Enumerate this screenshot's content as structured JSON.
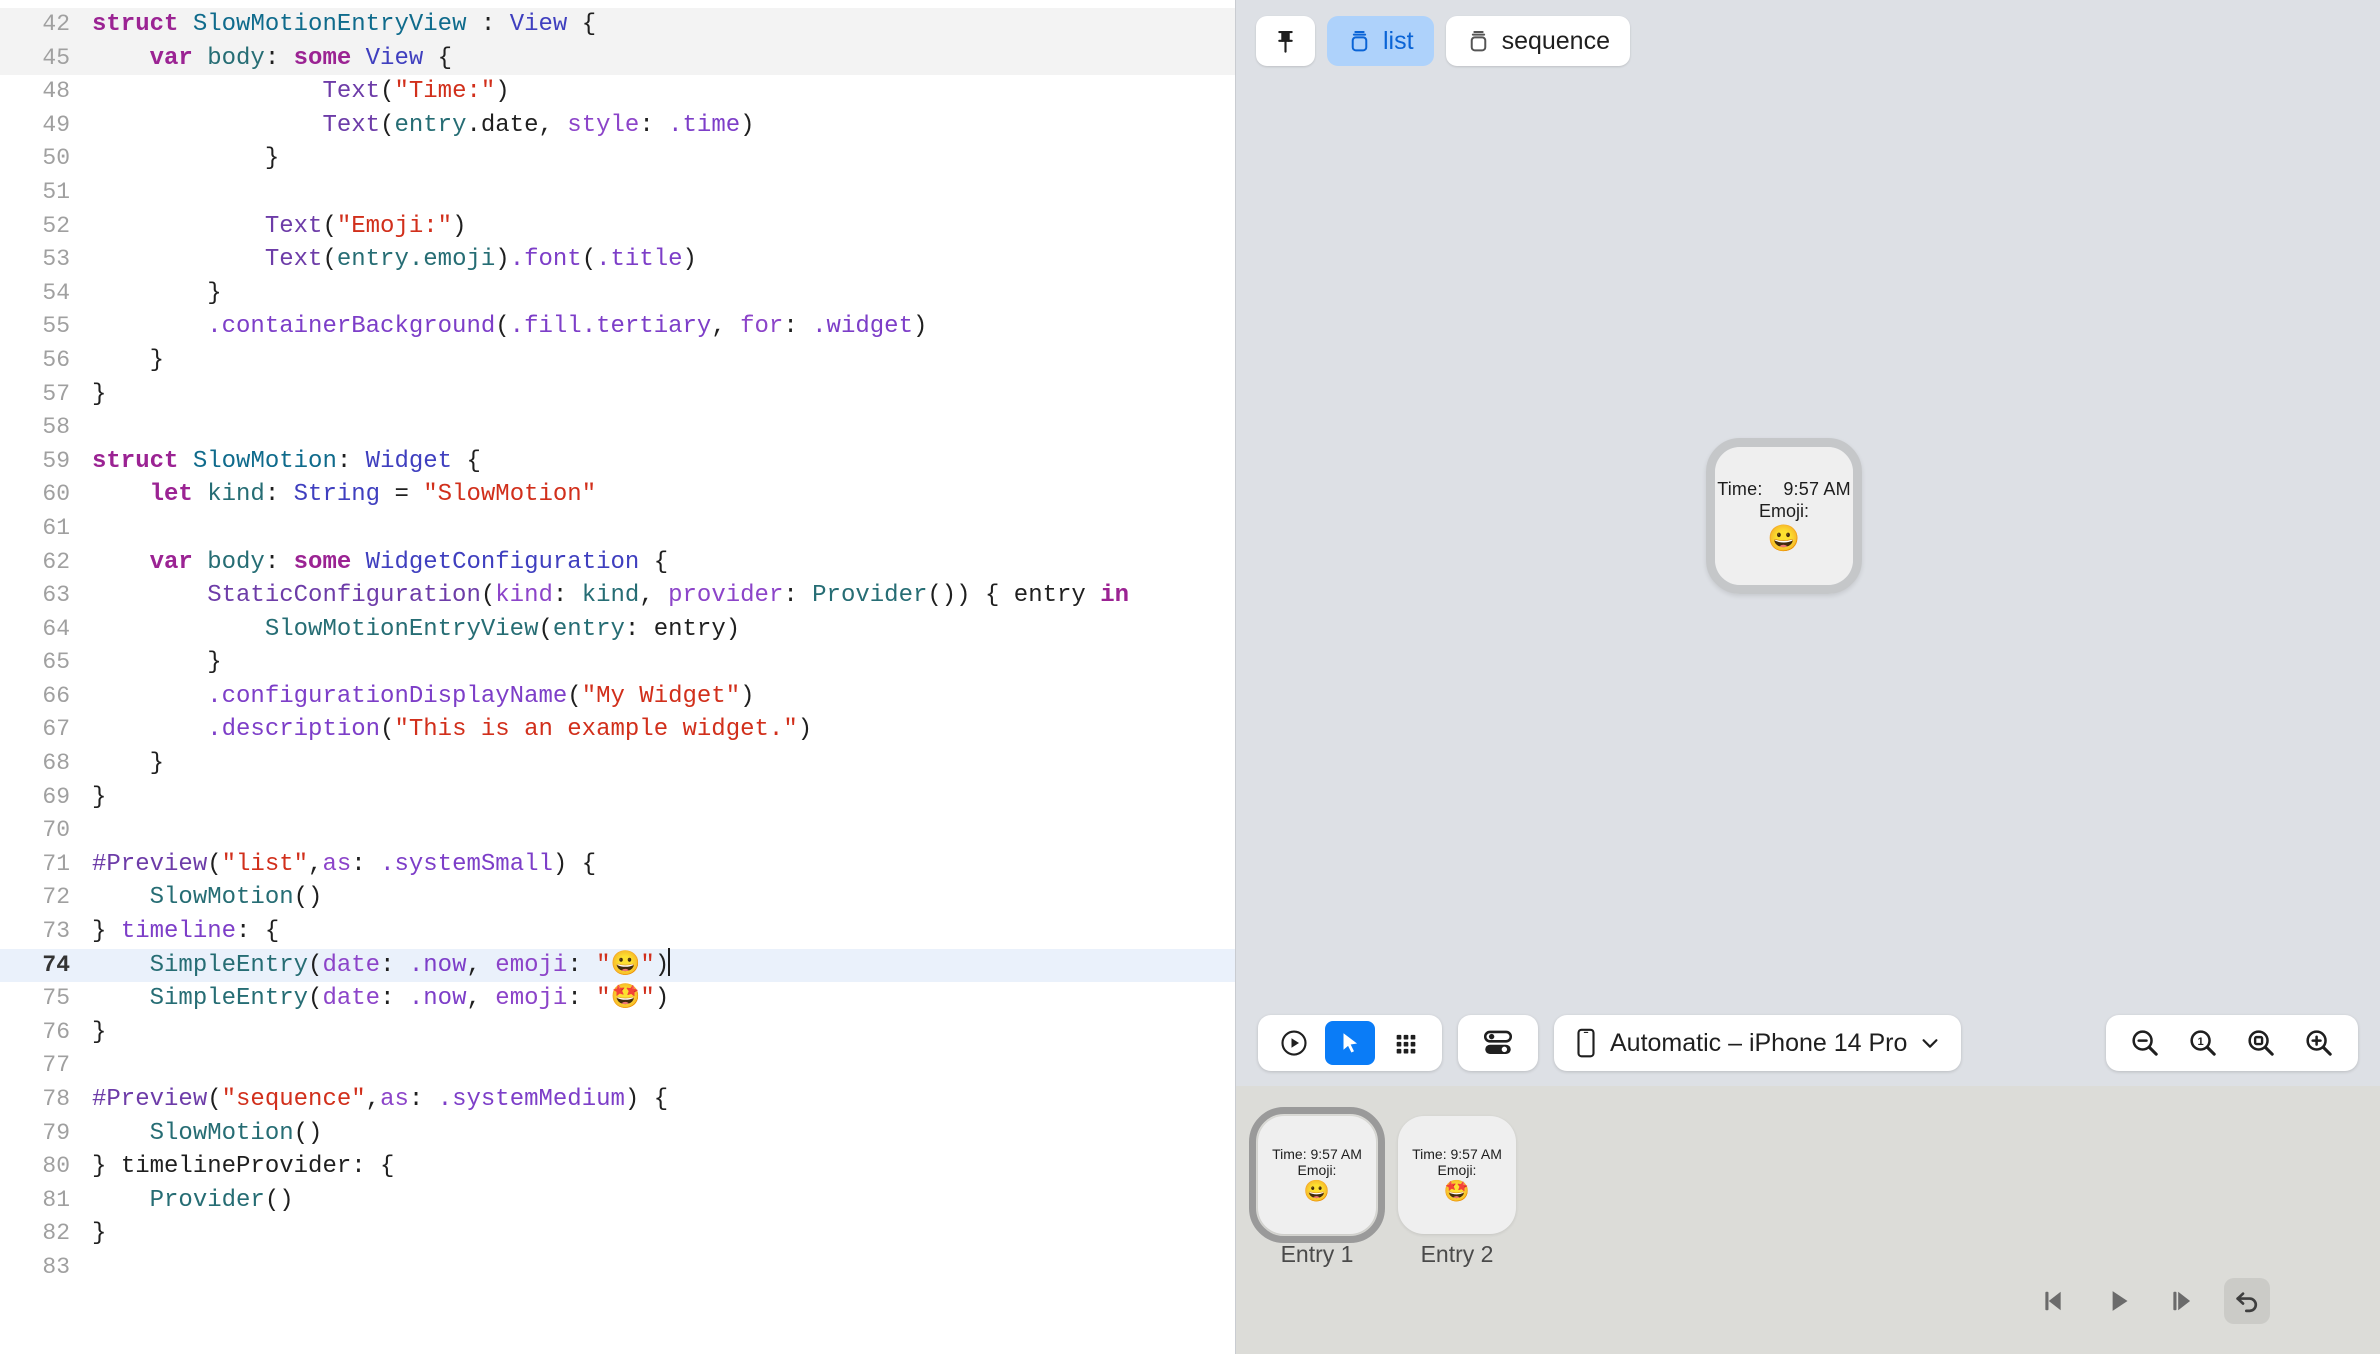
{
  "editor": {
    "language": "swift",
    "current_line": 74,
    "folded_lines": [
      42,
      45
    ],
    "lines": [
      {
        "no": "42",
        "state": "folded",
        "tokens": [
          {
            "t": "struct ",
            "c": "kw"
          },
          {
            "t": "SlowMotionEntryView",
            "c": "typ"
          },
          {
            "t": " : ",
            "c": "pln"
          },
          {
            "t": "View",
            "c": "typ2"
          },
          {
            "t": " {",
            "c": "pln"
          }
        ]
      },
      {
        "no": "45",
        "state": "folded",
        "indent": 1,
        "tokens": [
          {
            "t": "    ",
            "c": "pln"
          },
          {
            "t": "var ",
            "c": "kw"
          },
          {
            "t": "body",
            "c": "idn"
          },
          {
            "t": ": ",
            "c": "pln"
          },
          {
            "t": "some ",
            "c": "kw"
          },
          {
            "t": "View",
            "c": "typ2"
          },
          {
            "t": " {",
            "c": "pln"
          }
        ]
      },
      {
        "no": "48",
        "state": "normal",
        "tokens": [
          {
            "t": "                ",
            "c": "pln"
          },
          {
            "t": "Text",
            "c": "fn"
          },
          {
            "t": "(",
            "c": "pln"
          },
          {
            "t": "\"Time:\"",
            "c": "str"
          },
          {
            "t": ")",
            "c": "pln"
          }
        ]
      },
      {
        "no": "49",
        "state": "normal",
        "tokens": [
          {
            "t": "                ",
            "c": "pln"
          },
          {
            "t": "Text",
            "c": "fn"
          },
          {
            "t": "(",
            "c": "pln"
          },
          {
            "t": "entry",
            "c": "idn"
          },
          {
            "t": ".date",
            "c": "pln"
          },
          {
            "t": ", ",
            "c": "pln"
          },
          {
            "t": "style",
            "c": "plbl"
          },
          {
            "t": ": ",
            "c": "pln"
          },
          {
            "t": ".time",
            "c": "prop"
          },
          {
            "t": ")",
            "c": "pln"
          }
        ]
      },
      {
        "no": "50",
        "state": "normal",
        "tokens": [
          {
            "t": "            }",
            "c": "pln"
          }
        ]
      },
      {
        "no": "51",
        "state": "normal",
        "tokens": []
      },
      {
        "no": "52",
        "state": "normal",
        "tokens": [
          {
            "t": "            ",
            "c": "pln"
          },
          {
            "t": "Text",
            "c": "fn"
          },
          {
            "t": "(",
            "c": "pln"
          },
          {
            "t": "\"Emoji:\"",
            "c": "str"
          },
          {
            "t": ")",
            "c": "pln"
          }
        ]
      },
      {
        "no": "53",
        "state": "normal",
        "tokens": [
          {
            "t": "            ",
            "c": "pln"
          },
          {
            "t": "Text",
            "c": "fn"
          },
          {
            "t": "(",
            "c": "pln"
          },
          {
            "t": "entry",
            "c": "idn"
          },
          {
            "t": ".emoji",
            "c": "idn"
          },
          {
            "t": ")",
            "c": "pln"
          },
          {
            "t": ".font",
            "c": "prop"
          },
          {
            "t": "(",
            "c": "pln"
          },
          {
            "t": ".title",
            "c": "prop"
          },
          {
            "t": ")",
            "c": "pln"
          }
        ]
      },
      {
        "no": "54",
        "state": "normal",
        "tokens": [
          {
            "t": "        }",
            "c": "pln"
          }
        ]
      },
      {
        "no": "55",
        "state": "normal",
        "tokens": [
          {
            "t": "        ",
            "c": "pln"
          },
          {
            "t": ".containerBackground",
            "c": "prop"
          },
          {
            "t": "(",
            "c": "pln"
          },
          {
            "t": ".fill",
            "c": "prop"
          },
          {
            "t": ".tertiary",
            "c": "prop"
          },
          {
            "t": ", ",
            "c": "pln"
          },
          {
            "t": "for",
            "c": "plbl"
          },
          {
            "t": ": ",
            "c": "pln"
          },
          {
            "t": ".widget",
            "c": "prop"
          },
          {
            "t": ")",
            "c": "pln"
          }
        ]
      },
      {
        "no": "56",
        "state": "normal",
        "tokens": [
          {
            "t": "    }",
            "c": "pln"
          }
        ]
      },
      {
        "no": "57",
        "state": "normal",
        "tokens": [
          {
            "t": "}",
            "c": "pln"
          }
        ]
      },
      {
        "no": "58",
        "state": "normal",
        "tokens": []
      },
      {
        "no": "59",
        "state": "normal",
        "tokens": [
          {
            "t": "struct ",
            "c": "kw"
          },
          {
            "t": "SlowMotion",
            "c": "typ"
          },
          {
            "t": ": ",
            "c": "pln"
          },
          {
            "t": "Widget",
            "c": "typ2"
          },
          {
            "t": " {",
            "c": "pln"
          }
        ]
      },
      {
        "no": "60",
        "state": "normal",
        "tokens": [
          {
            "t": "    ",
            "c": "pln"
          },
          {
            "t": "let ",
            "c": "kw"
          },
          {
            "t": "kind",
            "c": "idn"
          },
          {
            "t": ": ",
            "c": "pln"
          },
          {
            "t": "String",
            "c": "typ2"
          },
          {
            "t": " = ",
            "c": "pln"
          },
          {
            "t": "\"SlowMotion\"",
            "c": "str"
          }
        ]
      },
      {
        "no": "61",
        "state": "normal",
        "tokens": []
      },
      {
        "no": "62",
        "state": "normal",
        "tokens": [
          {
            "t": "    ",
            "c": "pln"
          },
          {
            "t": "var ",
            "c": "kw"
          },
          {
            "t": "body",
            "c": "idn"
          },
          {
            "t": ": ",
            "c": "pln"
          },
          {
            "t": "some ",
            "c": "kw"
          },
          {
            "t": "WidgetConfiguration",
            "c": "typ2"
          },
          {
            "t": " {",
            "c": "pln"
          }
        ]
      },
      {
        "no": "63",
        "state": "normal",
        "tokens": [
          {
            "t": "        ",
            "c": "pln"
          },
          {
            "t": "StaticConfiguration",
            "c": "fn"
          },
          {
            "t": "(",
            "c": "pln"
          },
          {
            "t": "kind",
            "c": "plbl"
          },
          {
            "t": ": ",
            "c": "pln"
          },
          {
            "t": "kind",
            "c": "idn"
          },
          {
            "t": ", ",
            "c": "pln"
          },
          {
            "t": "provider",
            "c": "plbl"
          },
          {
            "t": ": ",
            "c": "pln"
          },
          {
            "t": "Provider",
            "c": "idn"
          },
          {
            "t": "()) { ",
            "c": "pln"
          },
          {
            "t": "entry",
            "c": "pln"
          },
          {
            "t": " ",
            "c": "pln"
          },
          {
            "t": "in",
            "c": "kw"
          }
        ]
      },
      {
        "no": "64",
        "state": "normal",
        "tokens": [
          {
            "t": "            ",
            "c": "pln"
          },
          {
            "t": "SlowMotionEntryView",
            "c": "idn"
          },
          {
            "t": "(",
            "c": "pln"
          },
          {
            "t": "entry",
            "c": "idn"
          },
          {
            "t": ": ",
            "c": "pln"
          },
          {
            "t": "entry",
            "c": "pln"
          },
          {
            "t": ")",
            "c": "pln"
          }
        ]
      },
      {
        "no": "65",
        "state": "normal",
        "tokens": [
          {
            "t": "        }",
            "c": "pln"
          }
        ]
      },
      {
        "no": "66",
        "state": "normal",
        "tokens": [
          {
            "t": "        ",
            "c": "pln"
          },
          {
            "t": ".configurationDisplayName",
            "c": "prop"
          },
          {
            "t": "(",
            "c": "pln"
          },
          {
            "t": "\"My Widget\"",
            "c": "str"
          },
          {
            "t": ")",
            "c": "pln"
          }
        ]
      },
      {
        "no": "67",
        "state": "normal",
        "tokens": [
          {
            "t": "        ",
            "c": "pln"
          },
          {
            "t": ".description",
            "c": "prop"
          },
          {
            "t": "(",
            "c": "pln"
          },
          {
            "t": "\"This is an example widget.\"",
            "c": "str"
          },
          {
            "t": ")",
            "c": "pln"
          }
        ]
      },
      {
        "no": "68",
        "state": "normal",
        "tokens": [
          {
            "t": "    }",
            "c": "pln"
          }
        ]
      },
      {
        "no": "69",
        "state": "normal",
        "tokens": [
          {
            "t": "}",
            "c": "pln"
          }
        ]
      },
      {
        "no": "70",
        "state": "normal",
        "tokens": []
      },
      {
        "no": "71",
        "state": "normal",
        "tokens": [
          {
            "t": "#Preview",
            "c": "macro"
          },
          {
            "t": "(",
            "c": "pln"
          },
          {
            "t": "\"list\"",
            "c": "str"
          },
          {
            "t": ",",
            "c": "pln"
          },
          {
            "t": "as",
            "c": "plbl"
          },
          {
            "t": ": ",
            "c": "pln"
          },
          {
            "t": ".systemSmall",
            "c": "prop"
          },
          {
            "t": ") {",
            "c": "pln"
          }
        ]
      },
      {
        "no": "72",
        "state": "normal",
        "tokens": [
          {
            "t": "    ",
            "c": "pln"
          },
          {
            "t": "SlowMotion",
            "c": "idn"
          },
          {
            "t": "()",
            "c": "pln"
          }
        ]
      },
      {
        "no": "73",
        "state": "normal",
        "tokens": [
          {
            "t": "} ",
            "c": "pln"
          },
          {
            "t": "timeline",
            "c": "prop"
          },
          {
            "t": ": {",
            "c": "pln"
          }
        ]
      },
      {
        "no": "74",
        "state": "current",
        "tokens": [
          {
            "t": "    ",
            "c": "pln"
          },
          {
            "t": "SimpleEntry",
            "c": "idn"
          },
          {
            "t": "(",
            "c": "pln"
          },
          {
            "t": "date",
            "c": "plbl"
          },
          {
            "t": ": ",
            "c": "pln"
          },
          {
            "t": ".now",
            "c": "prop"
          },
          {
            "t": ", ",
            "c": "pln"
          },
          {
            "t": "emoji",
            "c": "plbl"
          },
          {
            "t": ": ",
            "c": "pln"
          },
          {
            "t": "\"😀\"",
            "c": "str"
          },
          {
            "t": ")",
            "c": "pln"
          }
        ]
      },
      {
        "no": "75",
        "state": "normal",
        "tokens": [
          {
            "t": "    ",
            "c": "pln"
          },
          {
            "t": "SimpleEntry",
            "c": "idn"
          },
          {
            "t": "(",
            "c": "pln"
          },
          {
            "t": "date",
            "c": "plbl"
          },
          {
            "t": ": ",
            "c": "pln"
          },
          {
            "t": ".now",
            "c": "prop"
          },
          {
            "t": ", ",
            "c": "pln"
          },
          {
            "t": "emoji",
            "c": "plbl"
          },
          {
            "t": ": ",
            "c": "pln"
          },
          {
            "t": "\"🤩\"",
            "c": "str"
          },
          {
            "t": ")",
            "c": "pln"
          }
        ]
      },
      {
        "no": "76",
        "state": "normal",
        "tokens": [
          {
            "t": "}",
            "c": "pln"
          }
        ]
      },
      {
        "no": "77",
        "state": "normal",
        "tokens": []
      },
      {
        "no": "78",
        "state": "normal",
        "tokens": [
          {
            "t": "#Preview",
            "c": "macro"
          },
          {
            "t": "(",
            "c": "pln"
          },
          {
            "t": "\"sequence\"",
            "c": "str"
          },
          {
            "t": ",",
            "c": "pln"
          },
          {
            "t": "as",
            "c": "plbl"
          },
          {
            "t": ": ",
            "c": "pln"
          },
          {
            "t": ".systemMedium",
            "c": "prop"
          },
          {
            "t": ") {",
            "c": "pln"
          }
        ]
      },
      {
        "no": "79",
        "state": "normal",
        "tokens": [
          {
            "t": "    ",
            "c": "pln"
          },
          {
            "t": "SlowMotion",
            "c": "idn"
          },
          {
            "t": "()",
            "c": "pln"
          }
        ]
      },
      {
        "no": "80",
        "state": "normal",
        "tokens": [
          {
            "t": "} ",
            "c": "pln"
          },
          {
            "t": "timelineProvider",
            "c": "pln"
          },
          {
            "t": ": {",
            "c": "pln"
          }
        ]
      },
      {
        "no": "81",
        "state": "normal",
        "tokens": [
          {
            "t": "    ",
            "c": "pln"
          },
          {
            "t": "Provider",
            "c": "idn"
          },
          {
            "t": "()",
            "c": "pln"
          }
        ]
      },
      {
        "no": "82",
        "state": "normal",
        "tokens": [
          {
            "t": "}",
            "c": "pln"
          }
        ]
      },
      {
        "no": "83",
        "state": "normal",
        "tokens": []
      }
    ]
  },
  "preview": {
    "toolbar": {
      "pin_button": {
        "icon": "pin-icon",
        "label": ""
      },
      "tabs": [
        {
          "id": "list",
          "label": "list",
          "icon": "widget-small-icon",
          "active": true
        },
        {
          "id": "sequence",
          "label": "sequence",
          "icon": "widget-small-icon",
          "active": false
        }
      ]
    },
    "canvas": {
      "widget": {
        "time_label": "Time:",
        "time_value": "9:57 AM",
        "emoji_label": "Emoji:",
        "emoji": "😀"
      }
    },
    "bottom_bar": {
      "mode_buttons": [
        {
          "id": "live",
          "icon": "play-circle-icon",
          "selected": false
        },
        {
          "id": "select",
          "icon": "cursor-arrow-icon",
          "selected": true
        },
        {
          "id": "variants",
          "icon": "grid-dots-icon",
          "selected": false
        }
      ],
      "settings_button": {
        "id": "settings",
        "icon": "sliders-icon"
      },
      "device_selector": {
        "icon": "iphone-icon",
        "label": "Automatic – iPhone 14 Pro",
        "chevron": "chevron-down-icon"
      },
      "zoom_buttons": [
        {
          "id": "zoom-out",
          "icon": "magnifier-minus-icon"
        },
        {
          "id": "zoom-actual",
          "icon": "magnifier-one-icon"
        },
        {
          "id": "zoom-fit",
          "icon": "magnifier-square-icon"
        },
        {
          "id": "zoom-in",
          "icon": "magnifier-plus-icon"
        }
      ]
    },
    "thumbnails": [
      {
        "caption": "Entry 1",
        "selected": true,
        "time_label": "Time:",
        "time_value": "9:57 AM",
        "emoji_label": "Emoji:",
        "emoji": "😀"
      },
      {
        "caption": "Entry 2",
        "selected": false,
        "time_label": "Time:",
        "time_value": "9:57 AM",
        "emoji_label": "Emoji:",
        "emoji": "🤩"
      }
    ],
    "playback": [
      {
        "id": "step-back",
        "icon": "step-backward-icon",
        "boxed": false
      },
      {
        "id": "play",
        "icon": "play-icon",
        "boxed": false
      },
      {
        "id": "step-forward",
        "icon": "step-forward-icon",
        "boxed": false
      },
      {
        "id": "reset",
        "icon": "undo-arrow-icon",
        "boxed": true
      }
    ]
  },
  "colors": {
    "accent_blue": "#0a7cf7",
    "chip_active_bg": "#aed2fb",
    "chip_active_fg": "#0a64d6",
    "canvas_bg": "#dde0e5",
    "thumb_strip_bg": "#dcdcd8",
    "current_line_bg": "#eaf1fb",
    "folded_line_bg": "#f3f3f3"
  }
}
